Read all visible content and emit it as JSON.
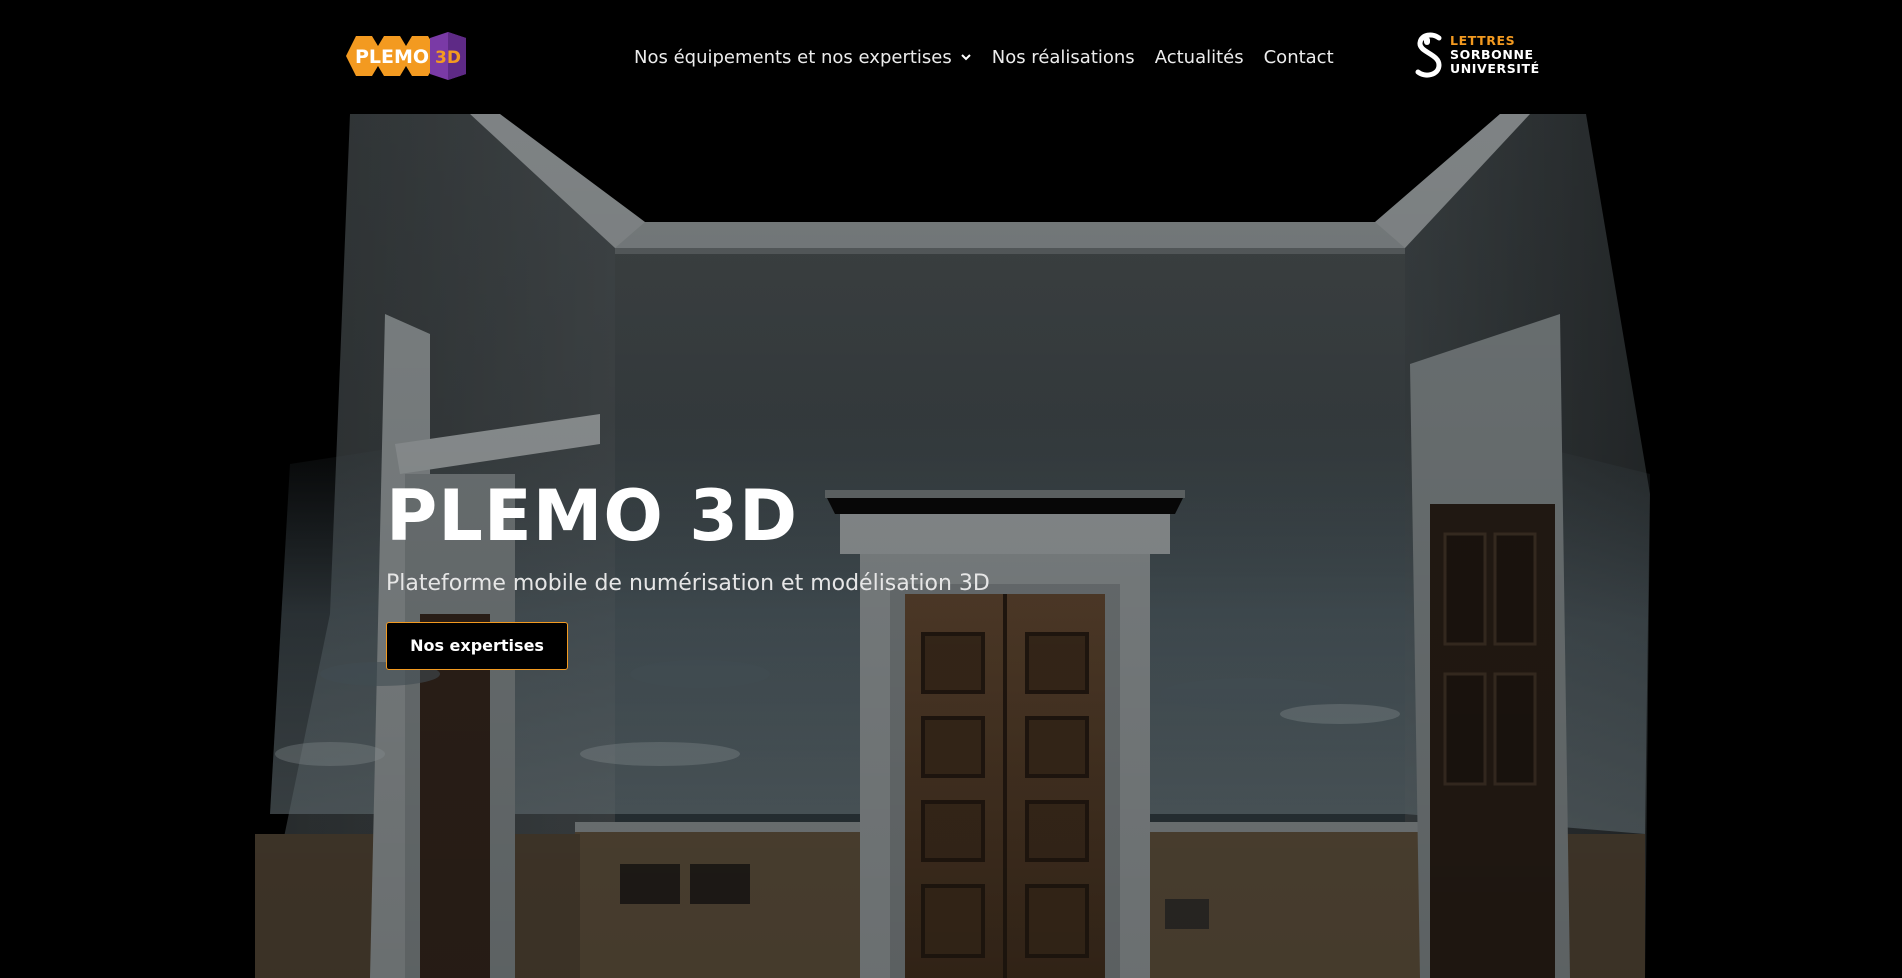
{
  "header": {
    "logo": {
      "word": "PLEMO",
      "badge": "3D",
      "colors": {
        "orange": "#f39a20",
        "purple": "#7a3aa6"
      }
    },
    "nav": [
      {
        "label": "Nos équipements et nos expertises",
        "has_dropdown": true
      },
      {
        "label": "Nos réalisations"
      },
      {
        "label": "Actualités"
      },
      {
        "label": "Contact"
      }
    ],
    "partner_logo": {
      "line1": "LETTRES",
      "line2": "SORBONNE",
      "line3": "UNIVERSITÉ"
    }
  },
  "hero": {
    "title": "PLEMO 3D",
    "subtitle": "Plateforme mobile de numérisation et modélisation 3D",
    "button_label": "Nos expertises",
    "background": "3D point-cloud scan of a room interior with painted walls and a double wooden door"
  },
  "colors": {
    "accent": "#f39a20",
    "background": "#000000",
    "text": "#ffffff"
  }
}
